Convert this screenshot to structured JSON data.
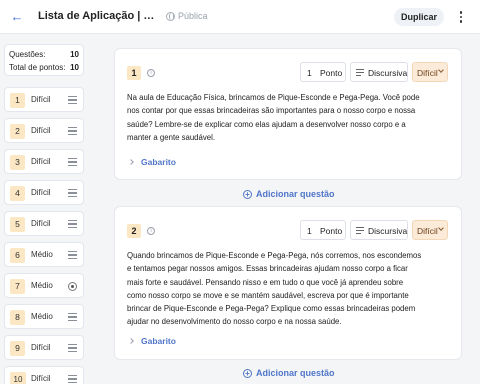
{
  "header": {
    "title": "Lista de Aplicação | Brincad...",
    "visibility": "Pública",
    "duplicate_label": "Duplicar"
  },
  "summary": {
    "questions_label": "Questões:",
    "questions_value": "10",
    "points_label": "Total de pontos:",
    "points_value": "10"
  },
  "sidebar": {
    "items": [
      {
        "number": "1",
        "difficulty": "Difícil"
      },
      {
        "number": "2",
        "difficulty": "Difícil"
      },
      {
        "number": "3",
        "difficulty": "Difícil"
      },
      {
        "number": "4",
        "difficulty": "Difícil"
      },
      {
        "number": "5",
        "difficulty": "Difícil"
      },
      {
        "number": "6",
        "difficulty": "Médio"
      },
      {
        "number": "7",
        "difficulty": "Médio"
      },
      {
        "number": "8",
        "difficulty": "Médio"
      },
      {
        "number": "9",
        "difficulty": "Difícil"
      },
      {
        "number": "10",
        "difficulty": "Difícil"
      }
    ]
  },
  "questions": [
    {
      "number": "1",
      "points_value": "1",
      "points_unit": "Ponto",
      "type": "Discursiva",
      "difficulty": "Difícil",
      "text": "Na aula de Educação Física, brincamos de Pique-Esconde e Pega-Pega. Você pode nos contar por que essas brincadeiras são importantes para o nosso corpo e nossa saúde? Lembre-se de explicar como elas ajudam a desenvolver nosso corpo e a manter a gente saudável.",
      "answer_label": "Gabarito"
    },
    {
      "number": "2",
      "points_value": "1",
      "points_unit": "Ponto",
      "type": "Discursiva",
      "difficulty": "Difícil",
      "text": "Quando brincamos de Pique-Esconde e Pega-Pega, nós corremos, nos escondemos e tentamos pegar nossos amigos. Essas brincadeiras ajudam nosso corpo a ficar mais forte e saudável. Pensando nisso e em tudo o que você já aprendeu sobre como nosso corpo se move e se mantém saudável, escreva por que é importante brincar de Pique-Esconde e Pega-Pega? Explique como essas brincadeiras podem ajudar no desenvolvimento do nosso corpo e na nossa saúde.",
      "answer_label": "Gabarito"
    }
  ],
  "add_question_label": "Adicionar questão",
  "colors": {
    "accent": "#5076c9",
    "badge_bg": "#fbe7c3",
    "difficulty_bg": "#fcebd9"
  }
}
